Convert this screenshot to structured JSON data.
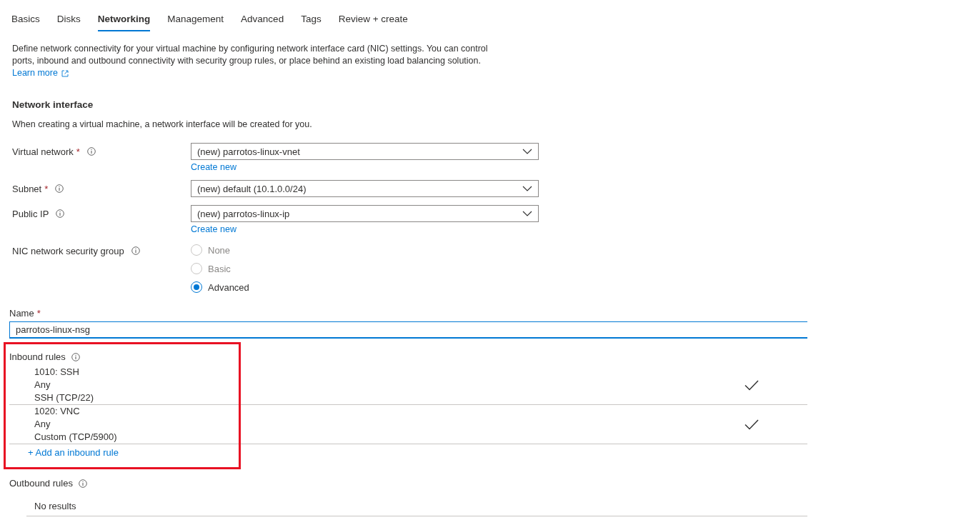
{
  "tabs": [
    {
      "label": "Basics",
      "selected": false
    },
    {
      "label": "Disks",
      "selected": false
    },
    {
      "label": "Networking",
      "selected": true
    },
    {
      "label": "Management",
      "selected": false
    },
    {
      "label": "Advanced",
      "selected": false
    },
    {
      "label": "Tags",
      "selected": false
    },
    {
      "label": "Review + create",
      "selected": false
    }
  ],
  "intro": {
    "text": "Define network connectivity for your virtual machine by configuring network interface card (NIC) settings. You can control ports, inbound and outbound connectivity with security group rules, or place behind an existing load balancing solution.",
    "link": "Learn more"
  },
  "network_interface": {
    "heading": "Network interface",
    "description": "When creating a virtual machine, a network interface will be created for you.",
    "fields": [
      {
        "kind": "dropdown",
        "label": "Virtual network",
        "required_mark": "*",
        "value": "(new) parrotos-linux-vnet",
        "link": "Create new"
      },
      {
        "kind": "dropdown",
        "label": "Subnet",
        "required_mark": "*",
        "value": "(new) default (10.1.0.0/24)"
      },
      {
        "kind": "dropdown",
        "label": "Public IP",
        "value": "(new) parrotos-linux-ip",
        "link": "Create new"
      },
      {
        "kind": "radio",
        "label": "NIC network security group",
        "options": [
          {
            "label": "None",
            "selected": false,
            "disabled": true
          },
          {
            "label": "Basic",
            "selected": false,
            "disabled": true
          },
          {
            "label": "Advanced",
            "selected": true,
            "disabled": false
          }
        ]
      }
    ]
  },
  "name_field": {
    "label": "Name",
    "required_mark": "*",
    "value": "parrotos-linux-nsg"
  },
  "inbound_rules": {
    "label": "Inbound rules",
    "highlighted": true,
    "rules": [
      {
        "priority_name": "1010: SSH",
        "source": "Any",
        "service": "SSH (TCP/22)",
        "checked": true
      },
      {
        "priority_name": "1020: VNC",
        "source": "Any",
        "service": "Custom (TCP/5900)",
        "checked": true
      }
    ],
    "add_link": "+ Add an inbound rule"
  },
  "outbound_rules": {
    "label": "Outbound rules",
    "empty_text": "No results"
  }
}
